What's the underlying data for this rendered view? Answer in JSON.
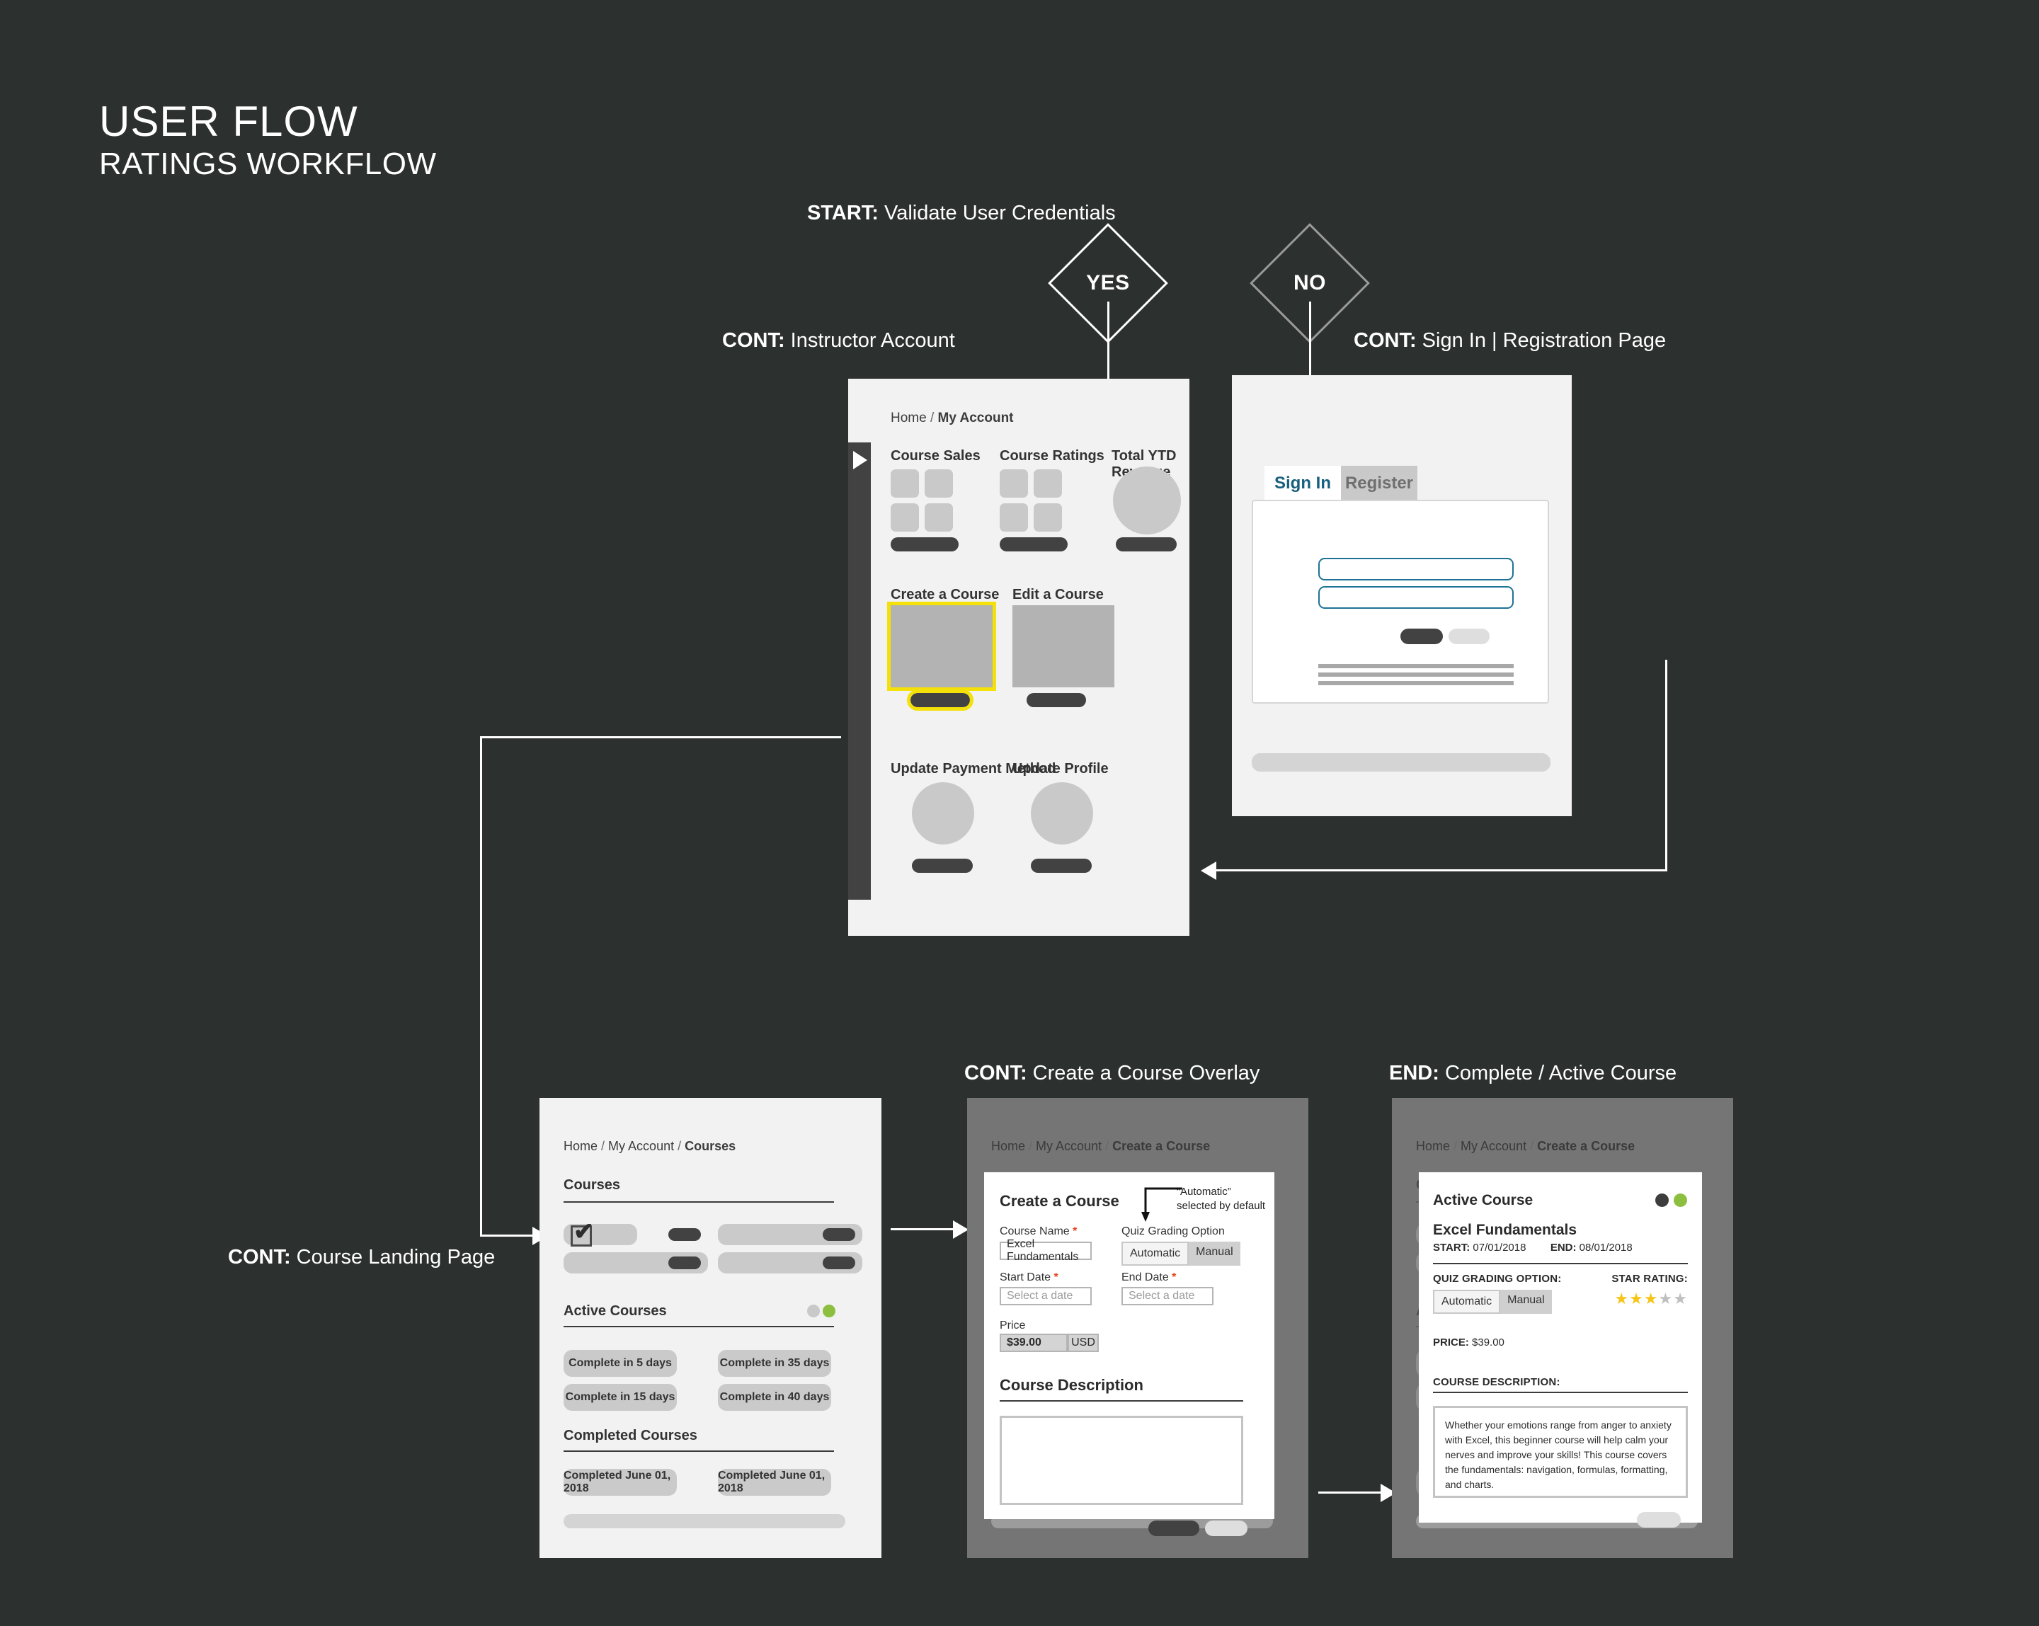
{
  "title": {
    "main": "USER FLOW",
    "sub": "RATINGS WORKFLOW"
  },
  "flow": {
    "start_label_bold": "START:",
    "start_label_text": " Validate User Credentials",
    "decision_yes": "YES",
    "decision_no": "NO",
    "cont_instructor_bold": "CONT:",
    "cont_instructor_text": " Instructor Account",
    "cont_signin_bold": "CONT:",
    "cont_signin_text": " Sign In | Registration Page",
    "cont_landing_bold": "CONT:",
    "cont_landing_text": " Course Landing Page",
    "cont_overlay_bold": "CONT:",
    "cont_overlay_text": " Create a Course Overlay",
    "end_bold": "END:",
    "end_text": " Complete / Active Course"
  },
  "instructor_panel": {
    "breadcrumb": {
      "home": "Home",
      "sep": "/",
      "current": "My Account"
    },
    "rail_icon": "play-triangle-icon",
    "stats": [
      {
        "label": "Course Sales"
      },
      {
        "label": "Course Ratings"
      },
      {
        "label": "Total YTD Revenue"
      }
    ],
    "actions_row1": [
      {
        "label": "Create a Course",
        "highlighted": true
      },
      {
        "label": "Edit a Course",
        "highlighted": false
      }
    ],
    "actions_row2": [
      {
        "label": "Update Payment Method"
      },
      {
        "label": "Update Profile"
      }
    ],
    "highlight_color": "#f4e10a"
  },
  "signin_panel": {
    "tabs": [
      {
        "label": "Sign In",
        "active": true
      },
      {
        "label": "Register",
        "active": false
      }
    ],
    "field_border_color": "#1e7296"
  },
  "landing_panel": {
    "breadcrumb": {
      "home": "Home",
      "account": "My Account",
      "current": "Courses"
    },
    "sections": [
      {
        "heading": "Courses"
      },
      {
        "heading": "Active Courses"
      },
      {
        "heading": "Completed Courses"
      }
    ],
    "checked_icon": "checkmark-icon",
    "status_dots": {
      "inactive_color": "#c9c9c9",
      "active_color": "#8cbf3f"
    },
    "active_courses": [
      "Complete in 5 days",
      "Complete in 35 days",
      "Complete in 15 days",
      "Complete in 40 days"
    ],
    "completed_courses": [
      "Completed  June 01, 2018",
      "Completed  June 01, 2018"
    ]
  },
  "overlay_panel": {
    "breadcrumb": {
      "home": "Home",
      "account": "My Account",
      "current": "Create a Course"
    },
    "modal_title": "Create a Course",
    "annotation_line1": "“Automatic”",
    "annotation_line2": "selected by default",
    "fields": {
      "course_name_label": "Course Name",
      "course_name_value": "Excel Fundamentals",
      "quiz_grading_label": "Quiz Grading Option",
      "quiz_option_automatic": "Automatic",
      "quiz_option_manual": "Manual",
      "start_date_label": "Start Date",
      "start_date_placeholder": "Select a date",
      "end_date_label": "End Date",
      "end_date_placeholder": "Select a date",
      "price_label": "Price",
      "price_value": "$39.00",
      "price_currency": "USD",
      "required_marker": "*"
    },
    "description_heading": "Course Description"
  },
  "end_panel": {
    "breadcrumb": {
      "home": "Home",
      "account": "My Account",
      "current": "Create a Course"
    },
    "card_title": "Active Course",
    "course_name": "Excel Fundamentals",
    "edit_icon": "pencil-icon",
    "start_label": "START:",
    "start_value": "07/01/2018",
    "end_label": "END:",
    "end_value": "08/01/2018",
    "quiz_grading_label": "QUIZ GRADING OPTION:",
    "quiz_option_automatic": "Automatic",
    "quiz_option_manual": "Manual",
    "star_rating_label": "STAR RATING:",
    "star_rating_value": 3,
    "star_rating_max": 5,
    "star_filled_color": "#f5c518",
    "star_empty_color": "#c0c0c0",
    "price_label": "PRICE:",
    "price_value": "$39.00",
    "description_label": "COURSE DESCRIPTION:",
    "description_text": "Whether your emotions range from anger to anxiety with Excel, this beginner course will help calm your nerves and improve your skills! This course covers the fundamentals: navigation, formulas, formatting, and charts.",
    "status_dots": {
      "dark_color": "#3d3d3d",
      "green_color": "#8cbf3f"
    }
  }
}
